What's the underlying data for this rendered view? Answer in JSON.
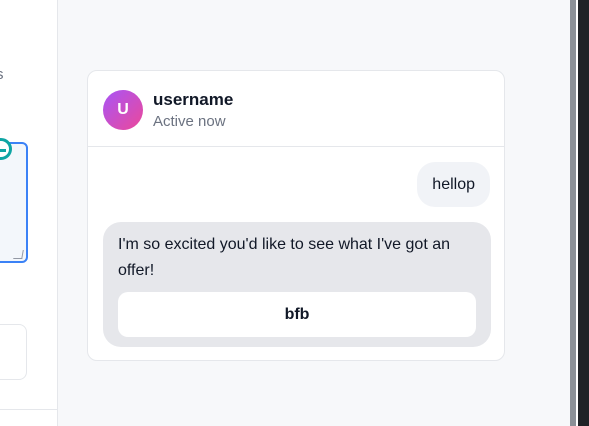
{
  "left_panel": {
    "partial_text": "s"
  },
  "chat": {
    "avatar_initial": "U",
    "username": "username",
    "status": "Active now",
    "messages": [
      {
        "from": "user",
        "text": "hellop"
      },
      {
        "from": "bot",
        "text": "I'm so excited you'd like to see what I've got an offer!",
        "button_label": "bfb"
      }
    ]
  },
  "colors": {
    "avatar_gradient_start": "#a855f7",
    "avatar_gradient_end": "#ec4899",
    "focus_border": "#3b82f6",
    "user_bubble": "#f1f3f7",
    "bot_bubble": "#e6e7eb"
  }
}
